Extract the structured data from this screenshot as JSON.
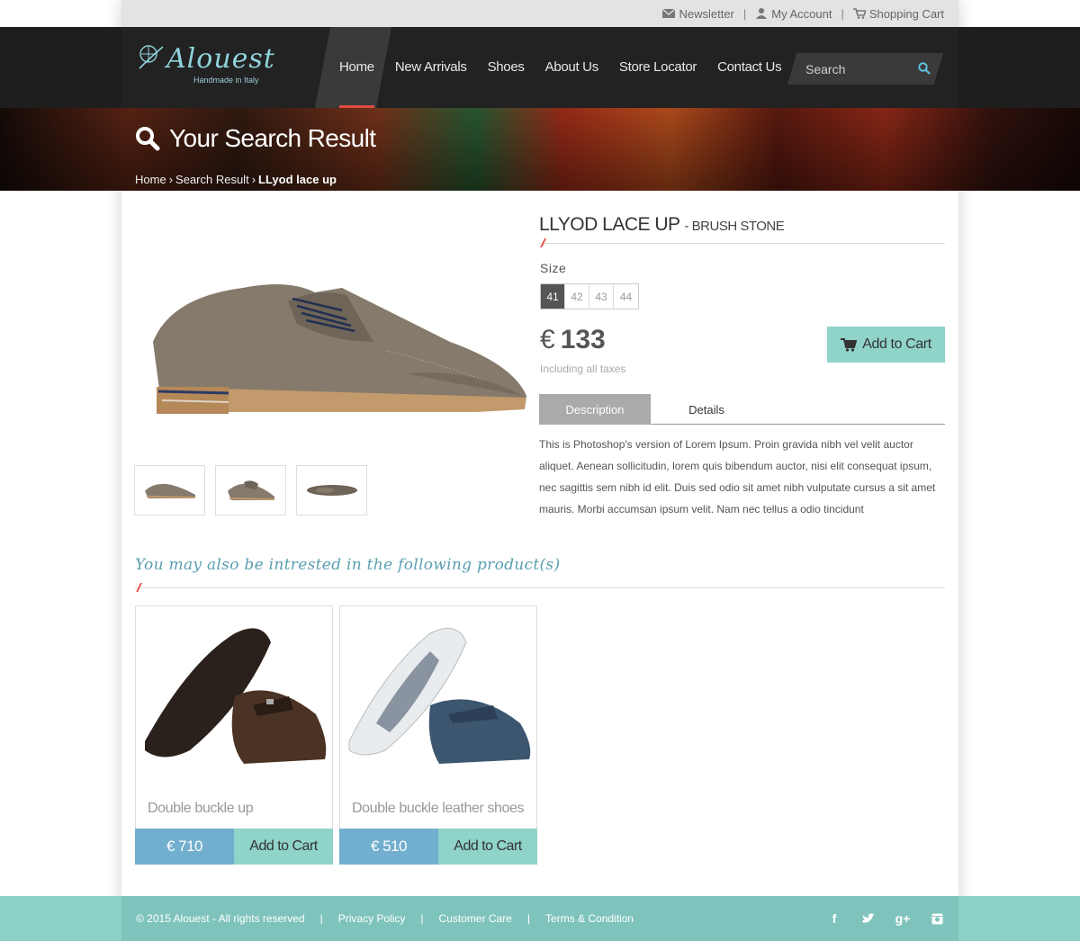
{
  "topbar": {
    "newsletter": "Newsletter",
    "my_account": "My Account",
    "shopping_cart": "Shopping Cart"
  },
  "logo": {
    "name": "Alouest",
    "tagline": "Handmade in Italy"
  },
  "nav": {
    "items": [
      {
        "label": "Home"
      },
      {
        "label": "New Arrivals"
      },
      {
        "label": "Shoes"
      },
      {
        "label": "About Us"
      },
      {
        "label": "Store Locator"
      },
      {
        "label": "Contact Us"
      }
    ],
    "active": "Home"
  },
  "search": {
    "placeholder": "Search"
  },
  "banner": {
    "title": "Your Search Result",
    "breadcrumb": [
      "Home",
      "Search Result",
      "LLyod lace up"
    ]
  },
  "product": {
    "name": "LLYOD LACE UP",
    "variant": "- BRUSH STONE",
    "size_label": "Size",
    "sizes": [
      "41",
      "42",
      "43",
      "44"
    ],
    "selected_size": "41",
    "currency": "€",
    "price": "133",
    "taxes_note": "Including all taxes",
    "add_to_cart": "Add to Cart",
    "tabs": [
      "Description",
      "Details"
    ],
    "active_tab": "Description",
    "description": "This is Photoshop's version  of Lorem Ipsum. Proin gravida nibh vel velit auctor aliquet. Aenean sollicitudin, lorem quis bibendum auctor, nisi elit consequat ipsum, nec sagittis sem nibh id elit. Duis sed odio sit amet nibh vulputate cursus a sit amet mauris. Morbi accumsan ipsum velit. Nam nec tellus a odio tincidunt"
  },
  "related": {
    "title": "You may also be intrested in the following product(s)",
    "items": [
      {
        "name": "Double buckle up",
        "price": "€ 710",
        "add_label": "Add to Cart"
      },
      {
        "name": "Double buckle leather shoes",
        "price": "€ 510",
        "add_label": "Add to Cart"
      }
    ]
  },
  "footer": {
    "copyright": "© 2015 Alouest - All rights reserved",
    "links": [
      "Privacy Policy",
      "Customer Care",
      "Terms & Condition"
    ],
    "social": [
      "facebook-icon",
      "twitter-icon",
      "google-plus-icon",
      "instagram-icon"
    ]
  },
  "colors": {
    "accent_teal": "#8fd3c9",
    "price_blue": "#72aecd",
    "active_red": "#e04a3f",
    "header_dark": "#222222"
  }
}
